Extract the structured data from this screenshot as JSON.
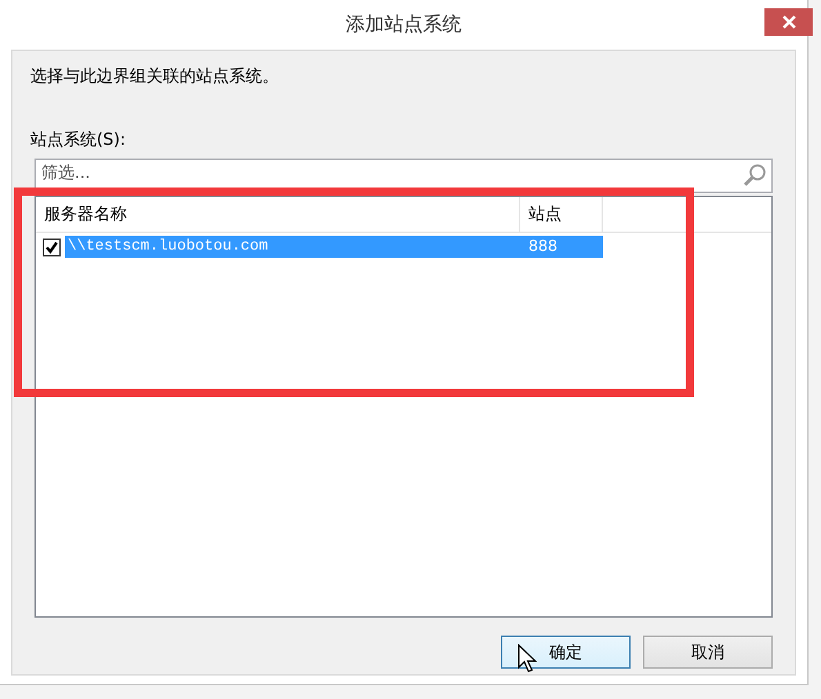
{
  "window": {
    "title": "添加站点系统"
  },
  "instruction": "选择与此边界组关联的站点系统。",
  "list_label": "站点系统(S):",
  "filter": {
    "placeholder": "筛选..."
  },
  "table": {
    "columns": [
      "服务器名称",
      "站点"
    ],
    "rows": [
      {
        "checked": true,
        "selected": true,
        "server": "\\\\testscm.luobotou.com",
        "site": "888"
      }
    ]
  },
  "buttons": [
    {
      "label": "确定",
      "focused": true
    },
    {
      "label": "取消",
      "focused": false
    }
  ],
  "annotation": {
    "kind": "highlight"
  }
}
